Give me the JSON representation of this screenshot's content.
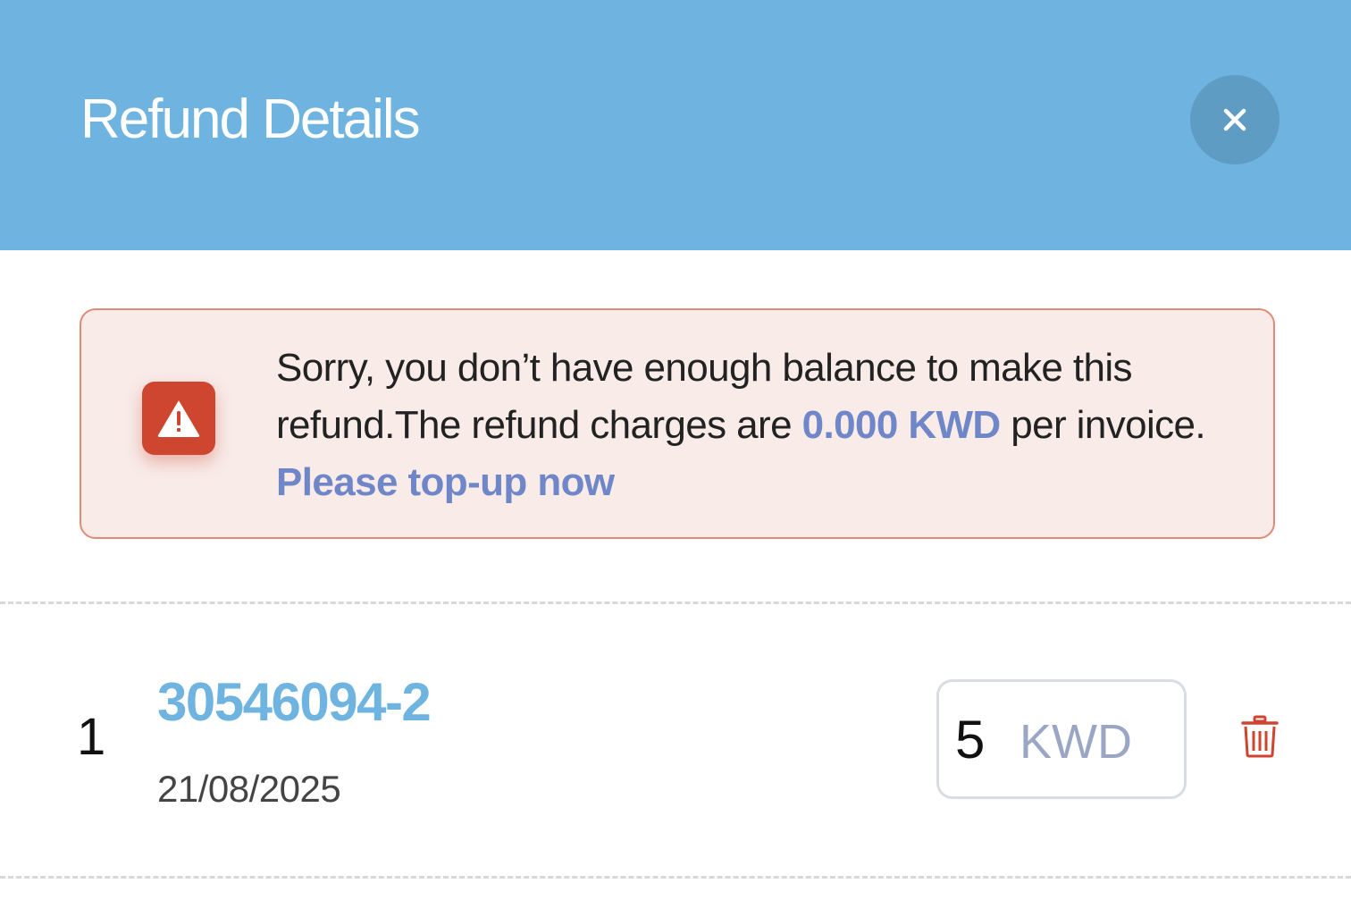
{
  "header": {
    "title": "Refund Details",
    "close_icon": "close-icon",
    "background_color": "#6fb3e0"
  },
  "alert": {
    "icon": "warning-icon",
    "message_part1": "Sorry, you don’t have enough balance to make this refund.The refund charges are ",
    "charge_amount": "0.000 KWD",
    "message_part2": " per invoice. ",
    "topup_link": "Please top-up now",
    "accent_color": "#cf4630",
    "link_color": "#6f87c8"
  },
  "refund_items": [
    {
      "index": "1",
      "invoice_id": "30546094-2",
      "date": "21/08/2025",
      "amount": "5",
      "currency": "KWD",
      "delete_icon": "trash-icon"
    }
  ]
}
